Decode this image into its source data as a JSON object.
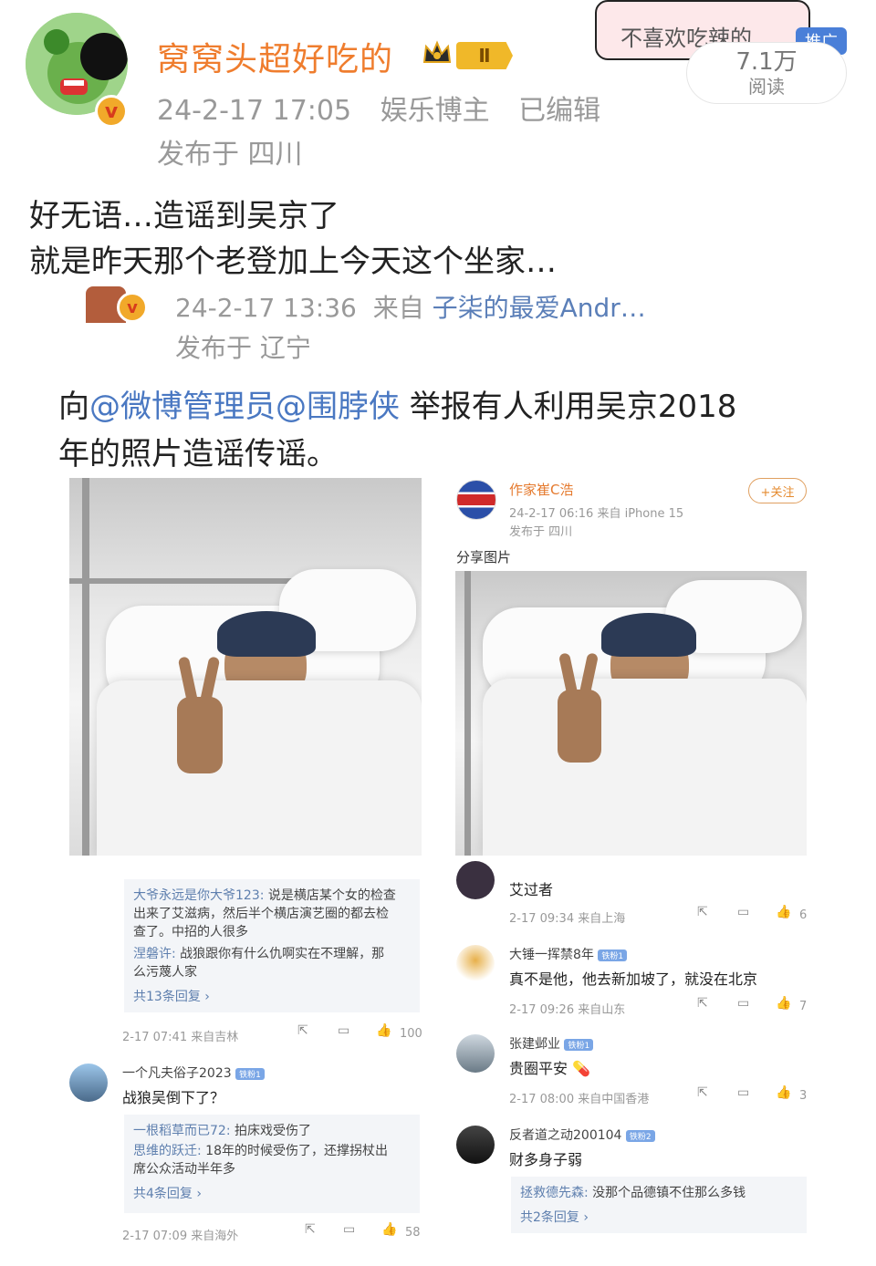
{
  "header": {
    "username": "窝窝头超好吃的",
    "rank_badge": "Ⅱ",
    "timestamp": "24-2-17 17:05",
    "role": "娱乐博主",
    "edited": "已编辑",
    "location": "发布于 四川",
    "sticker_text": "不喜欢吃辣的",
    "ad_label": "推广",
    "views_count": "7.1万",
    "views_label": "阅读"
  },
  "post": {
    "line1": "好无语…造谣到吴京了",
    "line2": "就是昨天那个老登加上今天这个坐家…"
  },
  "repost": {
    "timestamp": "24-2-17 13:36",
    "from_label": "来自",
    "source": "子柒的最爱Andr…",
    "location": "发布于 辽宁",
    "text_prefix": "向",
    "mention1": "@微博管理员",
    "mention2": "@围脖侠",
    "text_rest_line1": " 举报有人利用吴京2018",
    "text_line2": "年的照片造谣传谣。"
  },
  "left_shot": {
    "reply_block1": {
      "line1_name": "大爷永远是你大爷123:",
      "line1_text": " 说是横店某个女的检查",
      "line2": "出来了艾滋病，然后半个横店演艺圈的都去检",
      "line3": "查了。中招的人很多",
      "line4_name": "涅磐许:",
      "line4_text": " 战狼跟你有什么仇啊实在不理解，那",
      "line5": "么污蔑人家",
      "more": "共13条回复 ›"
    },
    "row1_meta": "2-17 07:41  来自吉林",
    "row1_likes": "100",
    "comment2": {
      "name": "一个凡夫俗子2023",
      "tag": "铁粉1",
      "text": "战狼吴倒下了？"
    },
    "reply_block2": {
      "line1_name": "一根稻草而已72:",
      "line1_text": " 拍床戏受伤了",
      "line2_name": "思维的跃迁:",
      "line2_text": " 18年的时候受伤了，还撑拐杖出",
      "line3": "席公众活动半年多",
      "more": "共4条回复 ›"
    },
    "row2_meta": "2-17 07:09  来自海外",
    "row2_likes": "58"
  },
  "right_shot": {
    "author": "作家崔C浩",
    "follow": "+关注",
    "meta": "24-2-17 06:16  来自 iPhone 15",
    "location": "发布于 四川",
    "share_label": "分享图片",
    "comments": [
      {
        "name": "",
        "text": "艾过者",
        "meta": "2-17 09:34  来自上海",
        "likes": "6"
      },
      {
        "name": "大锤一挥禁8年",
        "tag": "铁粉1",
        "text": "真不是他，他去新加坡了，就没在北京",
        "meta": "2-17 09:26  来自山东",
        "likes": "7"
      },
      {
        "name": "张建邺业",
        "tag": "铁粉1",
        "text": "贵圈平安",
        "meta": "2-17 08:00  来自中国香港",
        "likes": "3"
      },
      {
        "name": "反者道之动200104",
        "tag": "铁粉2",
        "text": "财多身子弱"
      }
    ],
    "reply": {
      "name": "拯救德先森:",
      "text": " 没那个品德镇不住那么多钱",
      "more": "共2条回复 ›"
    }
  },
  "colors": {
    "username": "#ef7d2e",
    "link": "#4a78c2",
    "meta_gray": "#999999",
    "ad_blue": "#4a7fd8"
  }
}
